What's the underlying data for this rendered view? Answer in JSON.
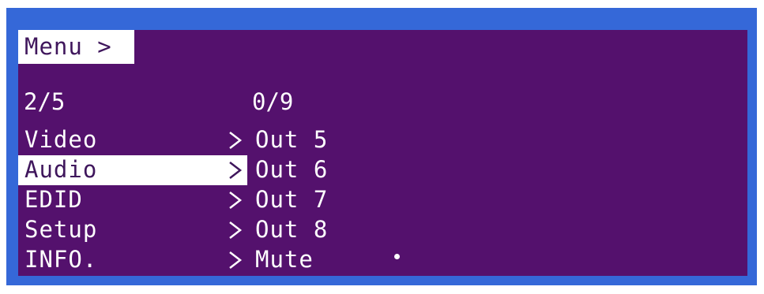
{
  "header": {
    "title": "Menu >"
  },
  "menu": {
    "page_counter": "2/5",
    "items": [
      {
        "label": "Video"
      },
      {
        "label": "Audio"
      },
      {
        "label": "EDID"
      },
      {
        "label": "Setup"
      },
      {
        "label": "INFO."
      }
    ],
    "selected_item": "Audio"
  },
  "submenu": {
    "counter": "0/9",
    "options": [
      {
        "label": "Out 5"
      },
      {
        "label": "Out 6"
      },
      {
        "label": "Out 7"
      },
      {
        "label": "Out 8"
      },
      {
        "label": "Mute"
      }
    ],
    "current_option": "Mute"
  },
  "colors": {
    "frame": "#3568d8",
    "screen_background": "#54116d",
    "highlight_background": "#ffffff",
    "highlight_text": "#3f165c",
    "text": "#ffffff"
  },
  "icons": {
    "submenu_arrow": "chevron-right-icon",
    "selection_marker": "dot-icon"
  }
}
